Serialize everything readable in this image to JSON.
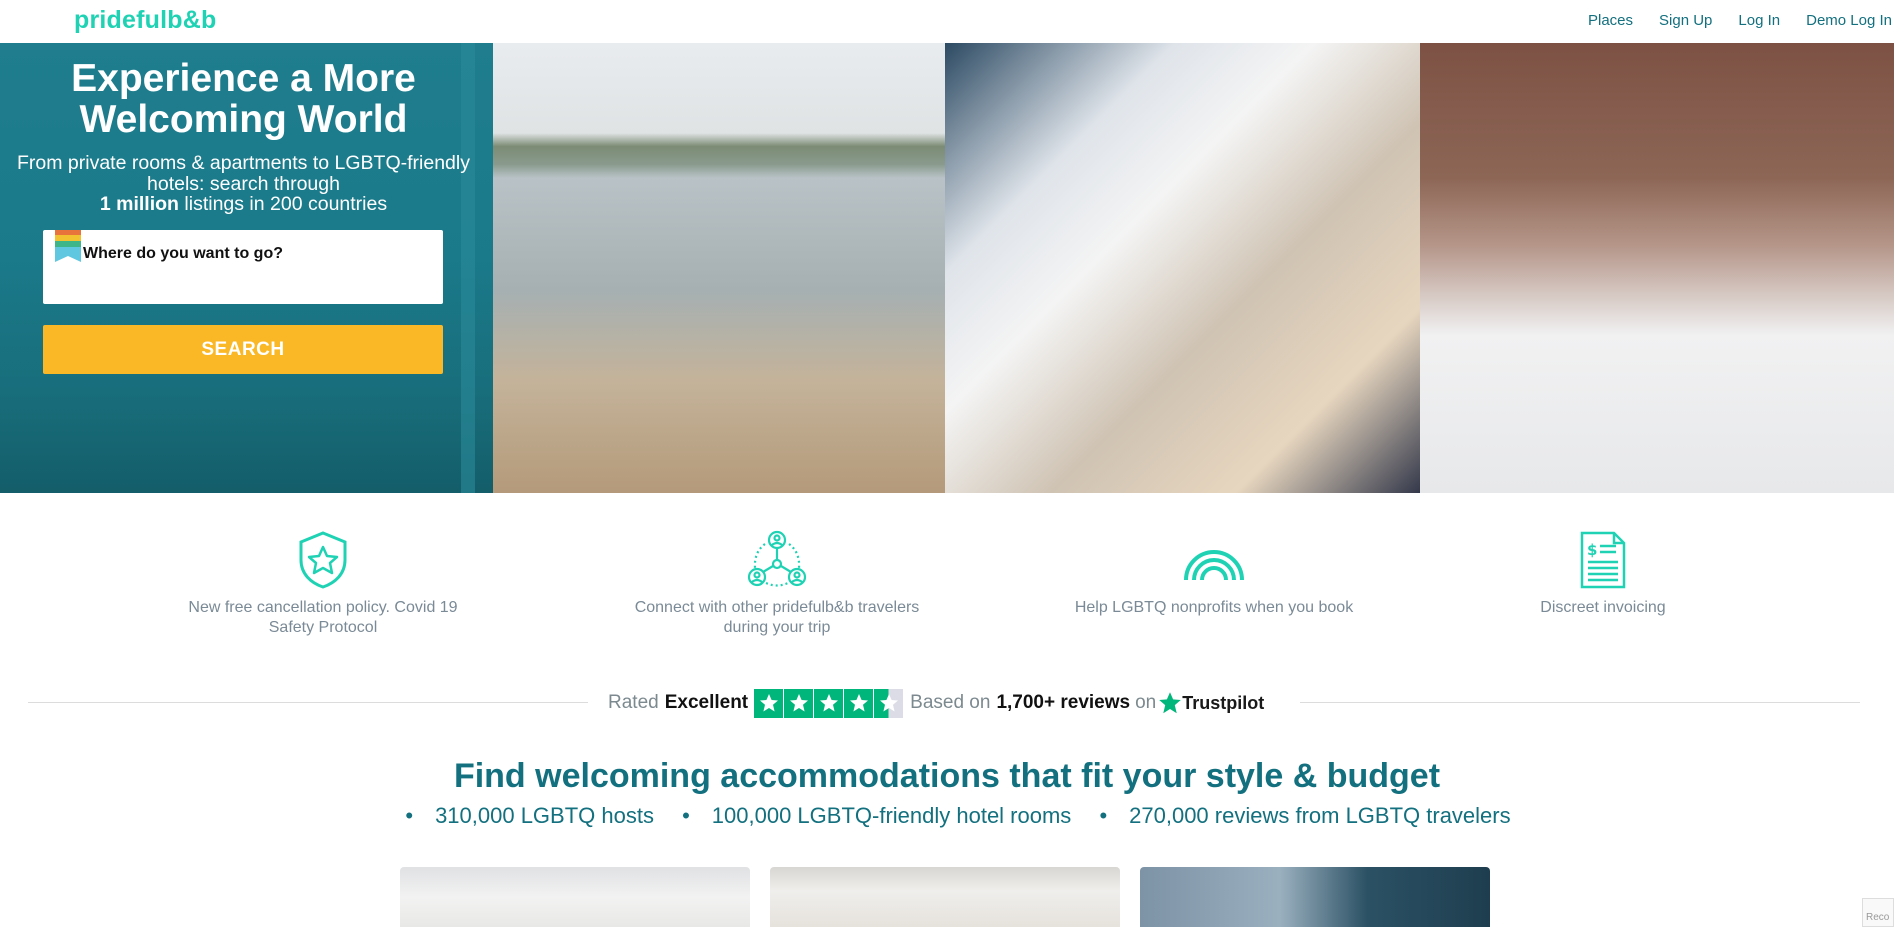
{
  "nav": {
    "logo": "pridefulb&b",
    "links": [
      "Places",
      "Sign Up",
      "Log In",
      "Demo Log In"
    ]
  },
  "hero": {
    "title": "Experience a More Welcoming World",
    "subtitle_pre": "From private rooms & apartments to LGBTQ-friendly hotels: search through",
    "subtitle_bold": "1 million",
    "subtitle_post": "listings in 200 countries",
    "search_placeholder": "Where do you want to go?",
    "search_button": "SEARCH"
  },
  "features": [
    {
      "icon": "shield-star-icon",
      "text": "New free cancellation policy. Covid 19 Safety Protocol"
    },
    {
      "icon": "network-people-icon",
      "text": "Connect with other pridefulb&b travelers during your trip"
    },
    {
      "icon": "rainbow-icon",
      "text": "Help LGBTQ nonprofits when you book"
    },
    {
      "icon": "invoice-document-icon",
      "text": "Discreet invoicing"
    }
  ],
  "trustpilot": {
    "rated": "Rated",
    "rating": "Excellent",
    "stars": 4.5,
    "based_on": "Based on",
    "reviews": "1,700+ reviews",
    "on": "on",
    "brand": "Trustpilot",
    "color": "#00b67a"
  },
  "section": {
    "headline": "Find welcoming accommodations that fit your style & budget",
    "stats": [
      "310,000 LGBTQ hosts",
      "100,000 LGBTQ-friendly hotel rooms",
      "270,000 reviews from LGBTQ travelers"
    ]
  },
  "recaptcha": "Reco",
  "colors": {
    "brand": "#1fd2b4",
    "primary": "#13707f",
    "hero_bg": "#1a7a8a",
    "button": "#fbb826"
  }
}
